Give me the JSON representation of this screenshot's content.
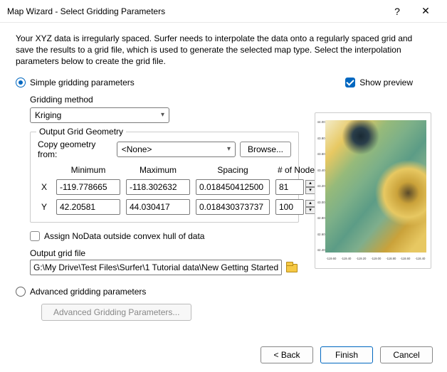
{
  "window": {
    "title": "Map Wizard - Select Gridding Parameters",
    "help": "?",
    "close": "✕"
  },
  "intro": "Your XYZ data is irregularly spaced. Surfer needs to interpolate the data onto a regularly spaced grid and save the results to a grid file, which is used to generate the selected map type. Select the interpolation parameters below to create the grid file.",
  "options": {
    "simple_label": "Simple gridding parameters",
    "show_preview_label": "Show preview",
    "advanced_label": "Advanced gridding parameters",
    "advanced_button": "Advanced Gridding Parameters..."
  },
  "gridding": {
    "method_label": "Gridding method",
    "method_value": "Kriging"
  },
  "geometry": {
    "legend": "Output Grid Geometry",
    "copy_label": "Copy geometry from:",
    "copy_value": "<None>",
    "browse": "Browse...",
    "headers": {
      "min": "Minimum",
      "max": "Maximum",
      "spacing": "Spacing",
      "nodes": "# of Nodes"
    },
    "rows": [
      {
        "axis": "X",
        "min": "-119.778665",
        "max": "-118.302632",
        "spacing": "0.018450412500",
        "nodes": "81"
      },
      {
        "axis": "Y",
        "min": "42.20581",
        "max": "44.030417",
        "spacing": "0.018430373737",
        "nodes": "100"
      }
    ]
  },
  "nodata": {
    "label": "Assign NoData outside convex hull of data"
  },
  "output": {
    "label": "Output grid file",
    "path": "G:\\My Drive\\Test Files\\Surfer\\1 Tutorial data\\New Getting Started Guide\\M"
  },
  "footer": {
    "back": "< Back",
    "finish": "Finish",
    "cancel": "Cancel"
  }
}
